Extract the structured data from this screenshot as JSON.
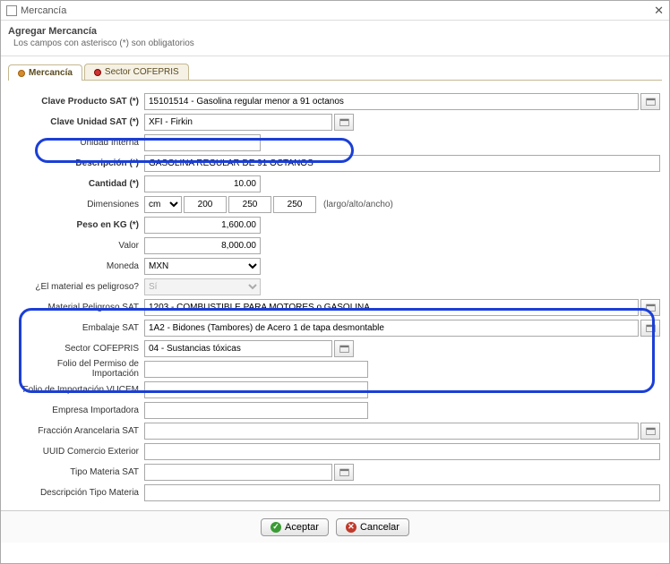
{
  "window": {
    "title": "Mercancía"
  },
  "header": {
    "title": "Agregar Mercancía",
    "subtitle": "Los campos con asterisco (*) son obligatorios"
  },
  "tabs": {
    "main": "Mercancía",
    "cofepris": "Sector COFEPRIS"
  },
  "labels": {
    "claveProductoSAT": "Clave Producto SAT (*)",
    "claveUnidadSAT": "Clave Unidad SAT (*)",
    "unidadInterna": "Unidad Interna",
    "descripcion": "Descripción (*)",
    "cantidad": "Cantidad (*)",
    "dimensiones": "Dimensiones",
    "dimHint": "(largo/alto/ancho)",
    "pesoKG": "Peso en KG (*)",
    "valor": "Valor",
    "moneda": "Moneda",
    "peligroso": "¿El material es peligroso?",
    "matPeligrosoSAT": "Material Peligroso SAT",
    "embalajeSAT": "Embalaje SAT",
    "sectorCOFEPRIS": "Sector COFEPRIS",
    "folioPermisoImport": "Folio del Permiso de Importación",
    "folioImportVUCEM": "Folio de Importación VUCEM",
    "empresaImportadora": "Empresa Importadora",
    "fraccionArancelaria": "Fracción Arancelaria SAT",
    "uuidComercioExt": "UUID Comercio Exterior",
    "tipoMateriaSAT": "Tipo Materia SAT",
    "descTipoMateria": "Descripción Tipo Materia"
  },
  "values": {
    "claveProductoSAT": "15101514 - Gasolina regular menor a 91 octanos",
    "claveUnidadSAT": "XFI - Firkin",
    "unidadInterna": "",
    "descripcion": "GASOLINA REGULAR DE 91 OCTANOS",
    "cantidad": "10.00",
    "dimUnit": "cm",
    "dimL": "200",
    "dimA": "250",
    "dimW": "250",
    "pesoKG": "1,600.00",
    "valor": "8,000.00",
    "moneda": "MXN",
    "peligroso": "Sí",
    "matPeligrosoSAT": "1203 - COMBUSTIBLE PARA MOTORES o GASOLINA",
    "embalajeSAT": "1A2 - Bidones (Tambores) de Acero 1 de tapa desmontable",
    "sectorCOFEPRIS": "04 - Sustancias tóxicas",
    "folioPermisoImport": "",
    "folioImportVUCEM": "",
    "empresaImportadora": "",
    "fraccionArancelaria": "",
    "uuidComercioExt": "",
    "tipoMateriaSAT": "",
    "descTipoMateria": ""
  },
  "footer": {
    "accept": "Aceptar",
    "cancel": "Cancelar"
  }
}
